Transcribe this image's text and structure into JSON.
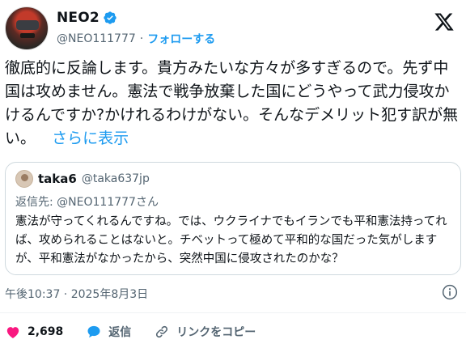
{
  "author": {
    "display_name": "NEO2",
    "handle": "@NEO111777",
    "separator": "·",
    "follow_label": "フォローする"
  },
  "post": {
    "text": "徹底的に反論します。貴方みたいな方々が多すぎるので。先ず中国は攻めません。憲法で戦争放棄した国にどうやって武力侵攻かけるんですか?かけれるわけがない。そんなデメリット犯す訳が無い。",
    "show_more_label": "さらに表示"
  },
  "quote": {
    "display_name": "taka6",
    "handle": "@taka637jp",
    "reply_to": "返信先: @NEO111777さん",
    "text": "憲法が守ってくれるんですね。では、ウクライナでもイランでも平和憲法持ってれば、攻められることはないと。チベットって極めて平和的な国だった気がしますが、平和憲法がなかったから、突然中国に侵攻されたのかな？"
  },
  "meta": {
    "timestamp": "午後10:37 · 2025年8月3日"
  },
  "actions": {
    "likes_count": "2,698",
    "reply_label": "返信",
    "copy_link_label": "リンクをコピー"
  },
  "colors": {
    "accent": "#1d9bf0",
    "like": "#f91880",
    "secondary_text": "#536471",
    "border": "#cfd9de"
  }
}
